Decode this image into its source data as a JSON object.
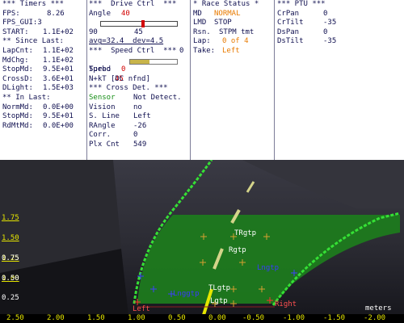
{
  "timers": {
    "header": "*** Timers ***",
    "fps_label": "FPS:",
    "fps_value": "8.26",
    "fps_gui_label": "FPS_GUI:3",
    "start_label": "START:",
    "start_value": "1.1E+02",
    "since_header": "** Since Last:",
    "items": [
      {
        "label": "LapCnt:",
        "value": "1.1E+02"
      },
      {
        "label": "MdChg:",
        "value": "1.1E+02"
      },
      {
        "label": "StopMd:",
        "value": "9.5E+01"
      },
      {
        "label": "CrossD:",
        "value": "3.6E+01"
      },
      {
        "label": "DLight:",
        "value": "1.5E+03"
      }
    ],
    "in_header": "** In Last:",
    "in_items": [
      {
        "label": "NormMd:",
        "value": "0.0E+00"
      },
      {
        "label": "StopMd:",
        "value": "9.5E+01"
      },
      {
        "label": "RdMtMd:",
        "value": "0.0E+00"
      }
    ]
  },
  "drive": {
    "header": "***  Drive Ctrl  ***",
    "angle_label": "Angle",
    "angle_value": "40",
    "slider_min": "90",
    "slider_max": "0",
    "slider_mid": "45",
    "slider_fraction": 0.56,
    "avg_text": "avg=32.4  dev=4.5",
    "speed_header": "***  Speed Ctrl  ***",
    "speed_label": "Speed",
    "speed_value": "45",
    "speed_fraction": 0.42,
    "turbo_label": "Turbo",
    "turbo_value": "0",
    "nkt_text": "N+kT [DC nfnd]",
    "cross_header": "*** Cross Det. ***",
    "cross_items": [
      {
        "label": "Sensor",
        "value": "Not Detect."
      },
      {
        "label": "Vision",
        "value": "no"
      },
      {
        "label": "S. Line",
        "value": "Left"
      },
      {
        "label": "RAngle",
        "value": "-26"
      },
      {
        "label": "Corr.",
        "value": "0"
      },
      {
        "label": "Plx Cnt",
        "value": "549"
      }
    ]
  },
  "race": {
    "header": "* Race Status *",
    "md_label": "MD",
    "md_value": "NORMAL",
    "lmd_label": "LMD",
    "lmd_value": "STOP",
    "rsn_label": "Rsn.",
    "rsn_value": "STPM tmt",
    "lap_label": "Lap:",
    "lap_value": "0 of 4",
    "take_label": "Take:",
    "take_value": "Left"
  },
  "ptu": {
    "header": "*** PTU ***",
    "items": [
      {
        "label": "CrPan",
        "value": "0"
      },
      {
        "label": "CrTilt",
        "value": "-35"
      },
      {
        "label": "DsPan",
        "value": "0"
      },
      {
        "label": "DsTilt",
        "value": "-35"
      }
    ]
  },
  "viewport": {
    "y_ticks": [
      "1.75",
      "1.50",
      "1.25",
      "1.00",
      "0.75",
      "0.50",
      "0.25"
    ],
    "x_ticks": [
      "2.50",
      "2.00",
      "1.50",
      "1.00",
      "0.50",
      "0.00",
      "-0.50",
      "-1.00",
      "-1.50",
      "-2.00"
    ],
    "units": "meters",
    "markers": [
      {
        "text": "TRgtp",
        "color": "#ffffff"
      },
      {
        "text": "Rgtp",
        "color": "#ffffff"
      },
      {
        "text": "Lngtp",
        "color": "#3a3aff"
      },
      {
        "text": "Lnggtp",
        "color": "#3a3aff"
      },
      {
        "text": "TLgtp",
        "color": "#ffffff"
      },
      {
        "text": "Lgtp",
        "color": "#ffffff"
      },
      {
        "text": "Left",
        "color": "#ff5050"
      },
      {
        "text": "Right",
        "color": "#ff5050"
      }
    ],
    "colors": {
      "track": "#1d7a1d",
      "edge": "#35e035",
      "yellow": "#e6e600",
      "tick_label": "#e6e600"
    }
  }
}
